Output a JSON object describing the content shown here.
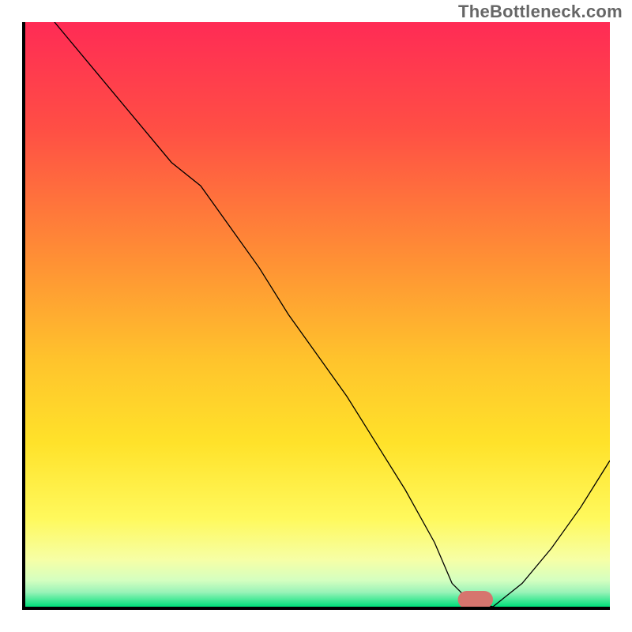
{
  "watermark": "TheBottleneck.com",
  "chart_data": {
    "type": "line",
    "title": "",
    "xlabel": "",
    "ylabel": "",
    "xlim": [
      0,
      100
    ],
    "ylim": [
      0,
      100
    ],
    "grid": false,
    "legend": false,
    "background_gradient": {
      "stops": [
        {
          "offset": 0.0,
          "color": "#ff2b55"
        },
        {
          "offset": 0.18,
          "color": "#ff4e45"
        },
        {
          "offset": 0.4,
          "color": "#ff8e35"
        },
        {
          "offset": 0.58,
          "color": "#ffc42c"
        },
        {
          "offset": 0.72,
          "color": "#ffe22a"
        },
        {
          "offset": 0.85,
          "color": "#fff95d"
        },
        {
          "offset": 0.92,
          "color": "#f6ffa6"
        },
        {
          "offset": 0.955,
          "color": "#d4ffc0"
        },
        {
          "offset": 0.975,
          "color": "#9af3b8"
        },
        {
          "offset": 1.0,
          "color": "#00e07a"
        }
      ]
    },
    "series": [
      {
        "name": "bottleneck-curve",
        "x": [
          5,
          10,
          15,
          20,
          25,
          30,
          35,
          40,
          45,
          50,
          55,
          60,
          65,
          70,
          73,
          76,
          80,
          85,
          90,
          95,
          100
        ],
        "y": [
          100,
          94,
          88,
          82,
          76,
          72,
          65,
          58,
          50,
          43,
          36,
          28,
          20,
          11,
          4,
          1,
          0,
          4,
          10,
          17,
          25
        ]
      }
    ],
    "marker": {
      "name": "optimal-zone",
      "x_center": 77,
      "y": 1.2,
      "width": 5,
      "height": 2.0,
      "color": "#d6756e"
    }
  }
}
